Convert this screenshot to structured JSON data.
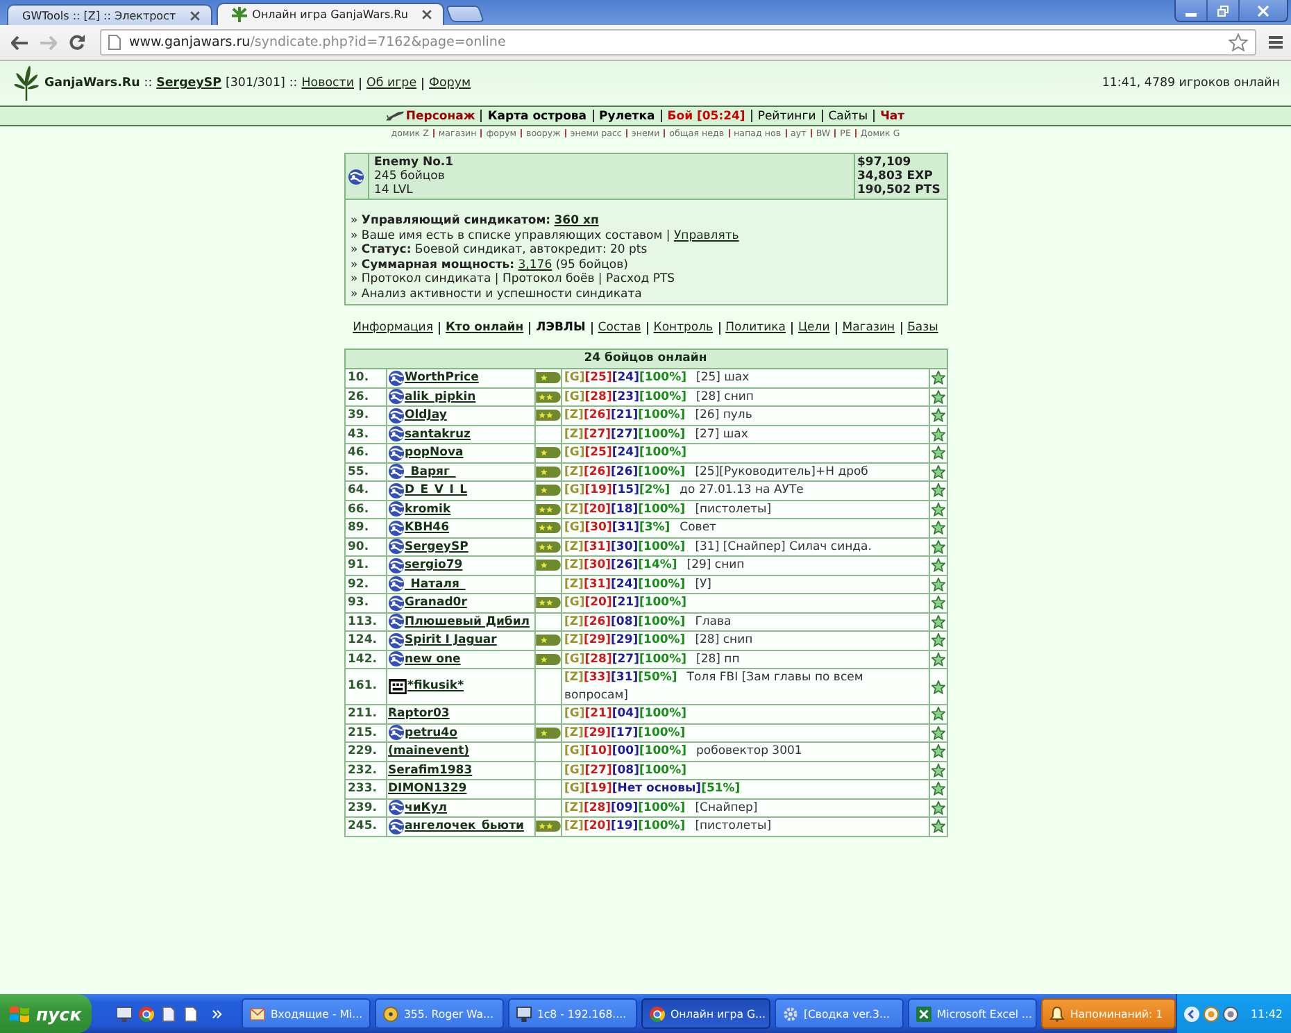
{
  "browser": {
    "tabs": [
      {
        "title": "GWTools :: [Z] :: Электрост",
        "favicon": false,
        "selected": false
      },
      {
        "title": "Онлайн игра GanjaWars.Ru",
        "favicon": true,
        "selected": true
      }
    ],
    "address": {
      "host": "www.ganjawars.ru",
      "path": "/syndicate.php?id=7162&page=online"
    }
  },
  "header": {
    "site": "GanjaWars.Ru",
    "separator_1": "::",
    "user": "SergeySP",
    "health": "[301/301]",
    "separator_2": "::",
    "links": [
      "Новости",
      "Об игре",
      "Форум"
    ],
    "online": "11:41, 4789 игроков онлайн"
  },
  "nav": {
    "items": [
      {
        "text": "Персонаж",
        "kind": "character",
        "bold": true,
        "color": "#990000"
      },
      {
        "text": "Карта острова",
        "kind": "link",
        "bold": true,
        "color": "#000000"
      },
      {
        "text": "Рулетка",
        "kind": "link",
        "bold": true,
        "color": "#000000"
      },
      {
        "text": "Бой [05:24]",
        "kind": "link",
        "bold": true,
        "color": "#cc0000"
      },
      {
        "text": "Рейтинги",
        "kind": "link",
        "bold": false,
        "color": "#000000"
      },
      {
        "text": "Сайты",
        "kind": "link",
        "bold": false,
        "color": "#000000"
      },
      {
        "text": "Чат",
        "kind": "link",
        "bold": true,
        "color": "#990000"
      }
    ]
  },
  "subnav": {
    "items": [
      "домик Z",
      "магазин",
      "форум",
      "вооруж",
      "энеми расс",
      "энеми",
      "общая недв",
      "напад нов",
      "аут",
      "BW",
      "PE",
      "Домик G"
    ]
  },
  "syndicate": {
    "name": "Enemy No.1",
    "members": "245 бойцов",
    "lvl": "14 LVL",
    "money": "$97,109",
    "exp": "34,803 EXP",
    "pts": "190,502 PTS",
    "lines": [
      {
        "parts": [
          {
            "kind": "text",
            "text": "»"
          },
          {
            "kind": "bold",
            "text": "Управляющий синдикатом:"
          },
          {
            "kind": "bold-link",
            "text": "360 хп"
          }
        ]
      },
      {
        "parts": [
          {
            "kind": "text",
            "text": "»"
          },
          {
            "kind": "text",
            "text": "Ваше имя есть в списке управляющих составом |"
          },
          {
            "kind": "link",
            "text": "Управлять"
          }
        ]
      },
      {
        "parts": [
          {
            "kind": "text",
            "text": "»"
          },
          {
            "kind": "bold",
            "text": "Статус:"
          },
          {
            "kind": "text",
            "text": "Боевой синдикат, автокредит: 20 pts"
          }
        ]
      },
      {
        "parts": [
          {
            "kind": "text",
            "text": "»"
          },
          {
            "kind": "bold",
            "text": "Суммарная мощность:"
          },
          {
            "kind": "link",
            "text": "3,176"
          },
          {
            "kind": "text",
            "text": "(95 бойцов)"
          }
        ]
      },
      {
        "parts": [
          {
            "kind": "text",
            "text": "»"
          },
          {
            "kind": "text",
            "text": "Протокол синдиката | Протокол боёв | Расход PTS"
          }
        ]
      },
      {
        "parts": [
          {
            "kind": "text",
            "text": "»"
          },
          {
            "kind": "text",
            "text": "Анализ активности и успешности синдиката"
          }
        ]
      }
    ]
  },
  "tabs": [
    {
      "label": "Информация",
      "kind": "link",
      "selected": false
    },
    {
      "label": "Кто онлайн",
      "kind": "link",
      "selected": true
    },
    {
      "label": "ЛЭВЛЫ",
      "kind": "label",
      "selected": false
    },
    {
      "label": "Состав",
      "kind": "link",
      "selected": false
    },
    {
      "label": "Контроль",
      "kind": "link",
      "selected": false
    },
    {
      "label": "Политика",
      "kind": "link",
      "selected": false
    },
    {
      "label": "Цели",
      "kind": "link",
      "selected": false
    },
    {
      "label": "Магазин",
      "kind": "link",
      "selected": false
    },
    {
      "label": "Базы",
      "kind": "link",
      "selected": false
    }
  ],
  "table": {
    "title": "24 бойцов онлайн",
    "rows": [
      {
        "num": "10.",
        "avatar": {
          "kind": "standard"
        },
        "name": "WorthPrice",
        "badge": {
          "kind": "single"
        },
        "tags": [
          "[G]",
          "[25]",
          "[24]",
          "[100%]"
        ],
        "note": "[25] шах"
      },
      {
        "num": "26.",
        "avatar": {
          "kind": "standard"
        },
        "name": "alik_pipkin",
        "badge": {
          "kind": "double"
        },
        "tags": [
          "[G]",
          "[28]",
          "[23]",
          "[100%]"
        ],
        "note": "[28] снип"
      },
      {
        "num": "39.",
        "avatar": {
          "kind": "standard"
        },
        "name": "OldJay",
        "badge": {
          "kind": "double"
        },
        "tags": [
          "[Z]",
          "[26]",
          "[21]",
          "[100%]"
        ],
        "note": "[26] пуль"
      },
      {
        "num": "43.",
        "avatar": {
          "kind": "standard"
        },
        "name": "santakruz",
        "tags": [
          "[Z]",
          "[27]",
          "[27]",
          "[100%]"
        ],
        "note": "[27] шах"
      },
      {
        "num": "46.",
        "avatar": {
          "kind": "standard"
        },
        "name": "popNova",
        "badge": {
          "kind": "single"
        },
        "tags": [
          "[G]",
          "[25]",
          "[24]",
          "[100%]"
        ]
      },
      {
        "num": "55.",
        "avatar": {
          "kind": "standard"
        },
        "name": "_Варяг_",
        "badge": {
          "kind": "single"
        },
        "tags": [
          "[Z]",
          "[26]",
          "[26]",
          "[100%]"
        ],
        "note": "[25][Руководитель]+Н дроб"
      },
      {
        "num": "64.",
        "avatar": {
          "kind": "standard"
        },
        "name": "D_E_V_I_L",
        "badge": {
          "kind": "single"
        },
        "tags": [
          "[G]",
          "[19]",
          "[15]",
          "[2%]"
        ],
        "note": "до 27.01.13 на АУТе"
      },
      {
        "num": "66.",
        "avatar": {
          "kind": "standard"
        },
        "name": "kromik",
        "badge": {
          "kind": "double"
        },
        "tags": [
          "[Z]",
          "[20]",
          "[18]",
          "[100%]"
        ],
        "note": "[пистолеты]"
      },
      {
        "num": "89.",
        "avatar": {
          "kind": "standard"
        },
        "name": "KBH46",
        "badge": {
          "kind": "double"
        },
        "tags": [
          "[G]",
          "[30]",
          "[31]",
          "[3%]"
        ],
        "note": "Совет"
      },
      {
        "num": "90.",
        "avatar": {
          "kind": "standard"
        },
        "name": "SergeySP",
        "badge": {
          "kind": "double"
        },
        "tags": [
          "[Z]",
          "[31]",
          "[30]",
          "[100%]"
        ],
        "note": "[31] [Снайпер] Силач синда."
      },
      {
        "num": "91.",
        "avatar": {
          "kind": "standard"
        },
        "name": "sergio79",
        "badge": {
          "kind": "single"
        },
        "tags": [
          "[Z]",
          "[30]",
          "[26]",
          "[14%]"
        ],
        "note": "[29] снип"
      },
      {
        "num": "92.",
        "avatar": {
          "kind": "standard"
        },
        "name": "_Наталя_",
        "tags": [
          "[Z]",
          "[31]",
          "[24]",
          "[100%]"
        ],
        "note": "[У]"
      },
      {
        "num": "93.",
        "avatar": {
          "kind": "standard"
        },
        "name": "Granad0r",
        "badge": {
          "kind": "double"
        },
        "tags": [
          "[G]",
          "[20]",
          "[21]",
          "[100%]"
        ]
      },
      {
        "num": "113.",
        "avatar": {
          "kind": "standard"
        },
        "name": "Плюшевый Дибил",
        "tags": [
          "[Z]",
          "[26]",
          "[08]",
          "[100%]"
        ],
        "note": "Глава"
      },
      {
        "num": "124.",
        "avatar": {
          "kind": "standard"
        },
        "name": "Spirit I Jaguar",
        "badge": {
          "kind": "single"
        },
        "tags": [
          "[Z]",
          "[29]",
          "[29]",
          "[100%]"
        ],
        "note": "[28] снип"
      },
      {
        "num": "142.",
        "avatar": {
          "kind": "standard"
        },
        "name": "new one",
        "badge": {
          "kind": "single"
        },
        "tags": [
          "[G]",
          "[28]",
          "[27]",
          "[100%]"
        ],
        "note": "[28] пп"
      },
      {
        "num": "161.",
        "avatar": {
          "kind": "custom"
        },
        "name": "*fikusik*",
        "tags": [
          "[Z]",
          "[33]",
          "[31]",
          "[50%]"
        ],
        "note": "Толя FBI [Зам главы по всем вопросам]"
      },
      {
        "num": "211.",
        "name": "Raptor03",
        "tags": [
          "[G]",
          "[21]",
          "[04]",
          "[100%]"
        ]
      },
      {
        "num": "215.",
        "avatar": {
          "kind": "standard"
        },
        "name": "petru4o",
        "badge": {
          "kind": "single"
        },
        "tags": [
          "[Z]",
          "[29]",
          "[17]",
          "[100%]"
        ]
      },
      {
        "num": "229.",
        "name": "(mainevent)",
        "tags": [
          "[G]",
          "[10]",
          "[00]",
          "[100%]"
        ],
        "note": "робовектор 3001"
      },
      {
        "num": "232.",
        "name": "Serafim1983",
        "tags": [
          "[G]",
          "[27]",
          "[08]",
          "[100%]"
        ]
      },
      {
        "num": "233.",
        "name": "DIMON1329",
        "tags": [
          "[G]",
          "[19]",
          "[Нет основы]",
          "[51%]"
        ]
      },
      {
        "num": "239.",
        "avatar": {
          "kind": "standard"
        },
        "name": "чиКул",
        "tags": [
          "[Z]",
          "[28]",
          "[09]",
          "[100%]"
        ],
        "note": "[Снайпер]"
      },
      {
        "num": "245.",
        "avatar": {
          "kind": "standard"
        },
        "name": "ангелочек_бьюти",
        "badge": {
          "kind": "double"
        },
        "tags": [
          "[Z]",
          "[20]",
          "[19]",
          "[100%]"
        ],
        "note": "[пистолеты]"
      }
    ]
  },
  "taskbar": {
    "start": "пуск",
    "tasks": [
      {
        "label": "Входящие - Mi...",
        "kind": "normal",
        "selected": false
      },
      {
        "label": "355. Roger Wa...",
        "kind": "normal",
        "selected": false
      },
      {
        "label": "1c8 - 192.168....",
        "kind": "normal",
        "selected": false
      },
      {
        "label": "Онлайн игра G...",
        "kind": "normal",
        "selected": true
      },
      {
        "label": "[Сводка ver.3...",
        "kind": "normal",
        "selected": false
      },
      {
        "label": "Microsoft Excel ...",
        "kind": "normal",
        "selected": false
      },
      {
        "label": "Напоминаний: 1",
        "kind": "alert",
        "selected": false
      }
    ],
    "clock": "11:42"
  }
}
